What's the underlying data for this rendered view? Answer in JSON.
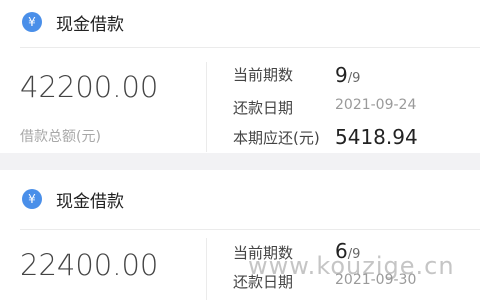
{
  "loans": [
    {
      "title": "现金借款",
      "amount": "42200.00",
      "amount_label": "借款总额(元)",
      "current_period_label": "当前期数",
      "current_period": "9",
      "total_periods": "/9",
      "repay_date_label": "还款日期",
      "repay_date": "2021-09-24",
      "due_label": "本期应还(元)",
      "due_amount": "5418.94"
    },
    {
      "title": "现金借款",
      "amount": "22400.00",
      "current_period_label": "当前期数",
      "current_period": "6",
      "total_periods": "/9",
      "repay_date_label": "还款日期",
      "repay_date": "2021-09-30"
    }
  ],
  "icon_symbol": "¥",
  "watermark": "www.kouzige.cn",
  "colors": {
    "accent": "#4a8fe9",
    "background": "#f2f2f4"
  }
}
